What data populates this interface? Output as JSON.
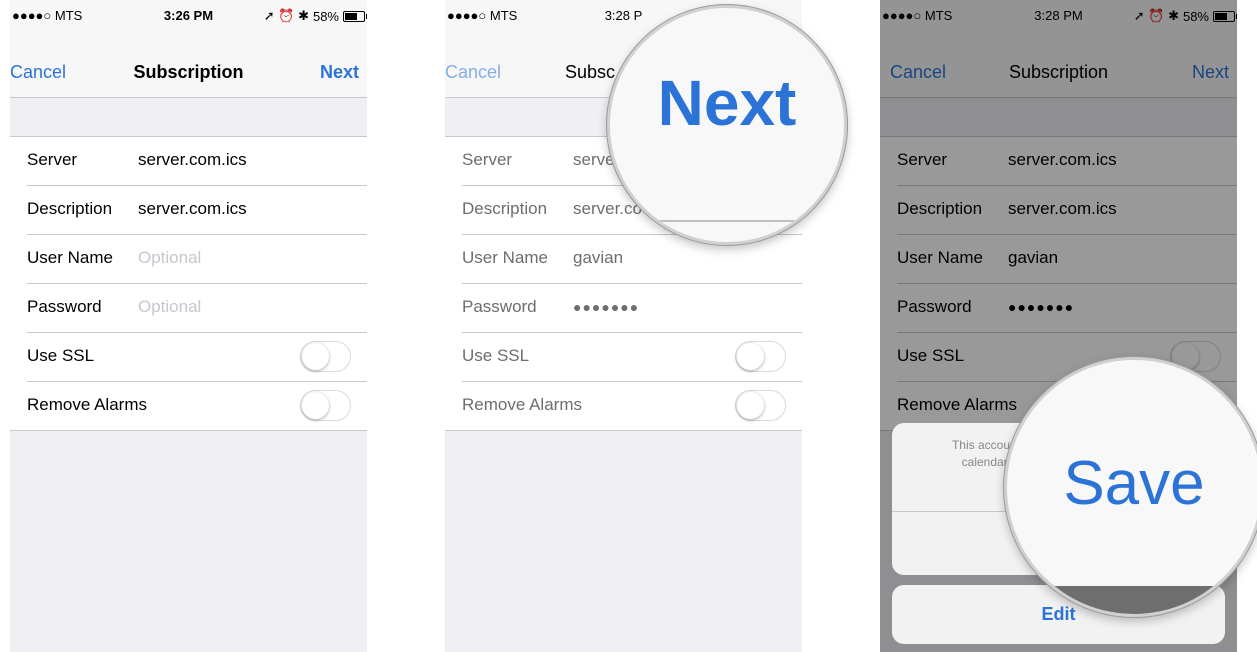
{
  "status_bar": {
    "carrier": "●●●●○ MTS",
    "wifi": "≈",
    "battery_pct": "58%",
    "time_1": "3:26 PM",
    "time_2": "3:28 PM",
    "time_3": "3:28 PM",
    "right_icons": "➚ ⏰ ✱"
  },
  "navbar": {
    "cancel": "Cancel",
    "title": "Subscription",
    "next": "Next"
  },
  "screen1": {
    "rows": [
      {
        "label": "Server",
        "value": "server.com.ics"
      },
      {
        "label": "Description",
        "value": "server.com.ics"
      },
      {
        "label": "User Name",
        "placeholder": "Optional"
      },
      {
        "label": "Password",
        "placeholder": "Optional"
      },
      {
        "label": "Use SSL",
        "toggle": false
      },
      {
        "label": "Remove Alarms",
        "toggle": false
      }
    ]
  },
  "screen2": {
    "rows": [
      {
        "label": "Server",
        "value": "serve"
      },
      {
        "label": "Description",
        "value": "server.co"
      },
      {
        "label": "User Name",
        "value": "gavian"
      },
      {
        "label": "Password",
        "value": "●●●●●●●"
      },
      {
        "label": "Use SSL"
      },
      {
        "label": "Remove Alarms"
      }
    ],
    "title_partial": "Subsc",
    "time_partial": "3:28 P",
    "magnified": "Next"
  },
  "screen3": {
    "rows": [
      {
        "label": "Server",
        "value": "server.com.ics"
      },
      {
        "label": "Description",
        "value": "server.com.ics"
      },
      {
        "label": "User Name",
        "value": "gavian"
      },
      {
        "label": "Password",
        "value": "●●●●●●●"
      },
      {
        "label": "Use SSL"
      },
      {
        "label": "Remove Alarms"
      }
    ],
    "sheet_message": "This account\ncalendar.",
    "edit": "Edit",
    "magnified": "Save"
  },
  "colors": {
    "ios_blue": "#2b73d6",
    "background": "#efeff4"
  }
}
